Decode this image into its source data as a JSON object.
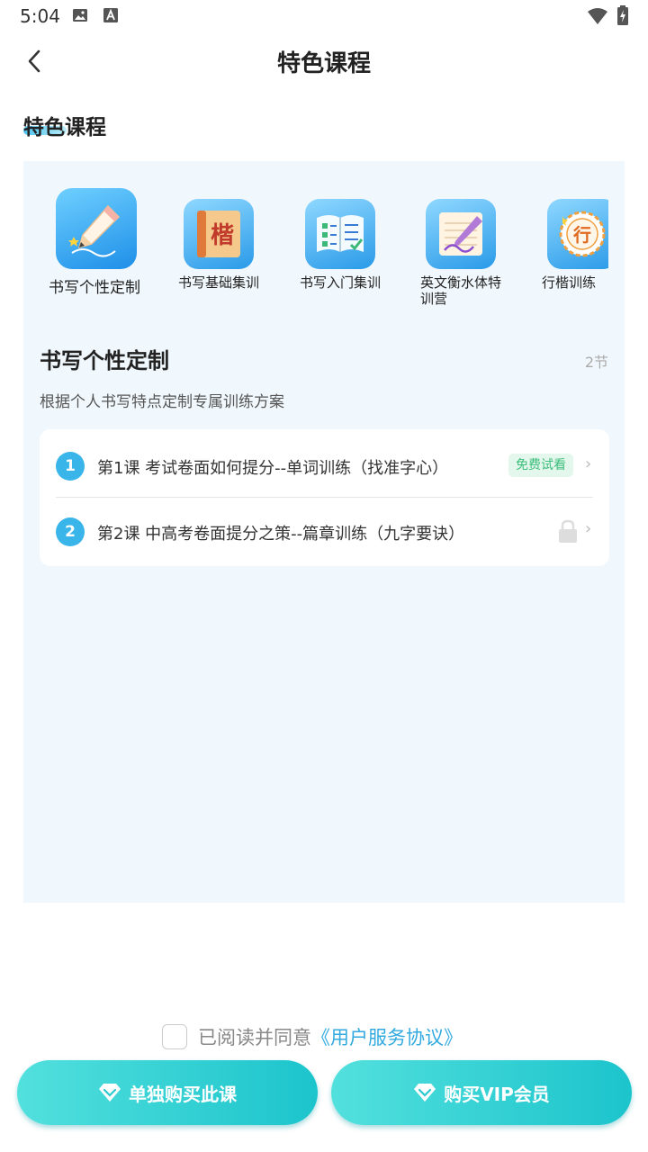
{
  "status_bar": {
    "time": "5:04"
  },
  "app_bar": {
    "title": "特色课程"
  },
  "section": {
    "heading": "特色课程"
  },
  "categories": [
    {
      "label": "书写个性定制",
      "icon": "pencil-icon",
      "selected": true
    },
    {
      "label": "书写基础集训",
      "icon": "kai-book-icon"
    },
    {
      "label": "书写入门集训",
      "icon": "checklist-book-icon"
    },
    {
      "label": "英文衡水体特训营",
      "icon": "notebook-pen-icon"
    },
    {
      "label": "行楷训练",
      "icon": "xing-badge-icon"
    }
  ],
  "course": {
    "title": "书写个性定制",
    "count": "2节",
    "description": "根据个人书写特点定制专属训练方案",
    "lessons": [
      {
        "number": "1",
        "title": "第1课 考试卷面如何提分--单词训练（找准字心）",
        "badge": "免费试看",
        "locked": false
      },
      {
        "number": "2",
        "title": "第2课 中高考卷面提分之策--篇章训练（九字要诀）",
        "locked": true
      }
    ]
  },
  "agreement": {
    "text": "已阅读并同意",
    "link": "《用户服务协议》",
    "checked": false
  },
  "buttons": {
    "buy_single": "单独购买此课",
    "buy_vip": "购买VIP会员"
  },
  "colors": {
    "accent": "#1cc4cc",
    "link": "#33aadf",
    "lesson_number": "#39b5ea",
    "panel_bg": "#f1f8fd"
  }
}
